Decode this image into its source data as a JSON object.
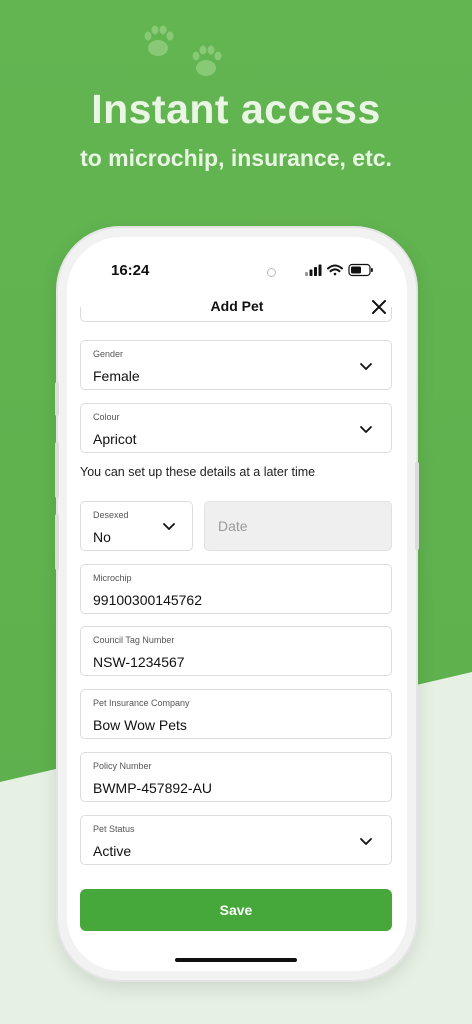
{
  "banner": {
    "headline": "Instant access",
    "subline": "to microchip, insurance, etc."
  },
  "status_bar": {
    "time": "16:24"
  },
  "modal": {
    "title": "Add Pet"
  },
  "form": {
    "gender": {
      "label": "Gender",
      "value": "Female"
    },
    "colour": {
      "label": "Colour",
      "value": "Apricot"
    },
    "note": "You can set up these details at a later time",
    "desexed": {
      "label": "Desexed",
      "value": "No"
    },
    "date": {
      "placeholder": "Date"
    },
    "microchip": {
      "label": "Microchip",
      "value": "99100300145762"
    },
    "council_tag": {
      "label": "Council Tag Number",
      "value": "NSW-1234567"
    },
    "insurance_company": {
      "label": "Pet Insurance Company",
      "value": "Bow Wow Pets"
    },
    "policy_number": {
      "label": "Policy Number",
      "value": "BWMP-457892-AU"
    },
    "pet_status": {
      "label": "Pet Status",
      "value": "Active"
    }
  },
  "save_label": "Save",
  "colors": {
    "background_green": "#63b552",
    "accent_button": "#46a83a",
    "banner_text": "#eaf6e4"
  },
  "icons": [
    "paw-print-icon",
    "signal-icon",
    "wifi-icon",
    "battery-icon",
    "close-icon",
    "chevron-down-icon"
  ]
}
